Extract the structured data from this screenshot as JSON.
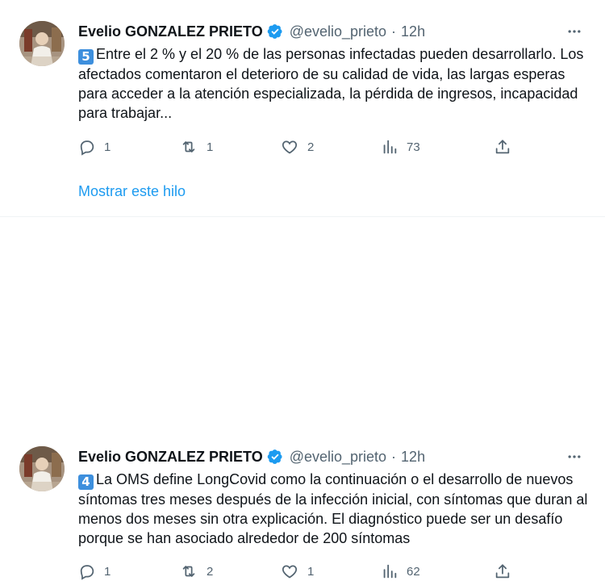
{
  "tweets": [
    {
      "author_name": "Evelio GONZALEZ PRIETO",
      "handle": "@evelio_prieto",
      "separator": "·",
      "time": "12h",
      "badge_number": "5",
      "text": "Entre el 2 % y el 20 % de las personas infectadas pueden desarrollarlo. Los afectados comentaron el deterioro de su calidad de vida, las largas esperas para acceder a la atención especializada, la pérdida de ingresos, incapacidad para trabajar...",
      "replies": "1",
      "retweets": "1",
      "likes": "2",
      "views": "73",
      "show_thread": "Mostrar este hilo"
    },
    {
      "author_name": "Evelio GONZALEZ PRIETO",
      "handle": "@evelio_prieto",
      "separator": "·",
      "time": "12h",
      "badge_number": "4",
      "text": "La OMS define LongCovid como la continuación o el desarrollo de nuevos síntomas tres meses después de la infección inicial, con síntomas que duran al menos dos meses sin otra explicación. El diagnóstico puede ser un desafío porque se han asociado alrededor de 200 síntomas",
      "replies": "1",
      "retweets": "2",
      "likes": "1",
      "views": "62"
    }
  ],
  "icons": {
    "verified": "verified-badge-icon",
    "more": "more-horizontal-icon",
    "reply": "reply-icon",
    "retweet": "retweet-icon",
    "like": "heart-icon",
    "views": "views-chart-icon",
    "share": "share-icon"
  },
  "colors": {
    "verified_blue": "#1d9bf0",
    "link_blue": "#1d9bf0",
    "muted_gray": "#536471",
    "text_dark": "#0f1419",
    "badge_blue": "#3d8fdd"
  }
}
